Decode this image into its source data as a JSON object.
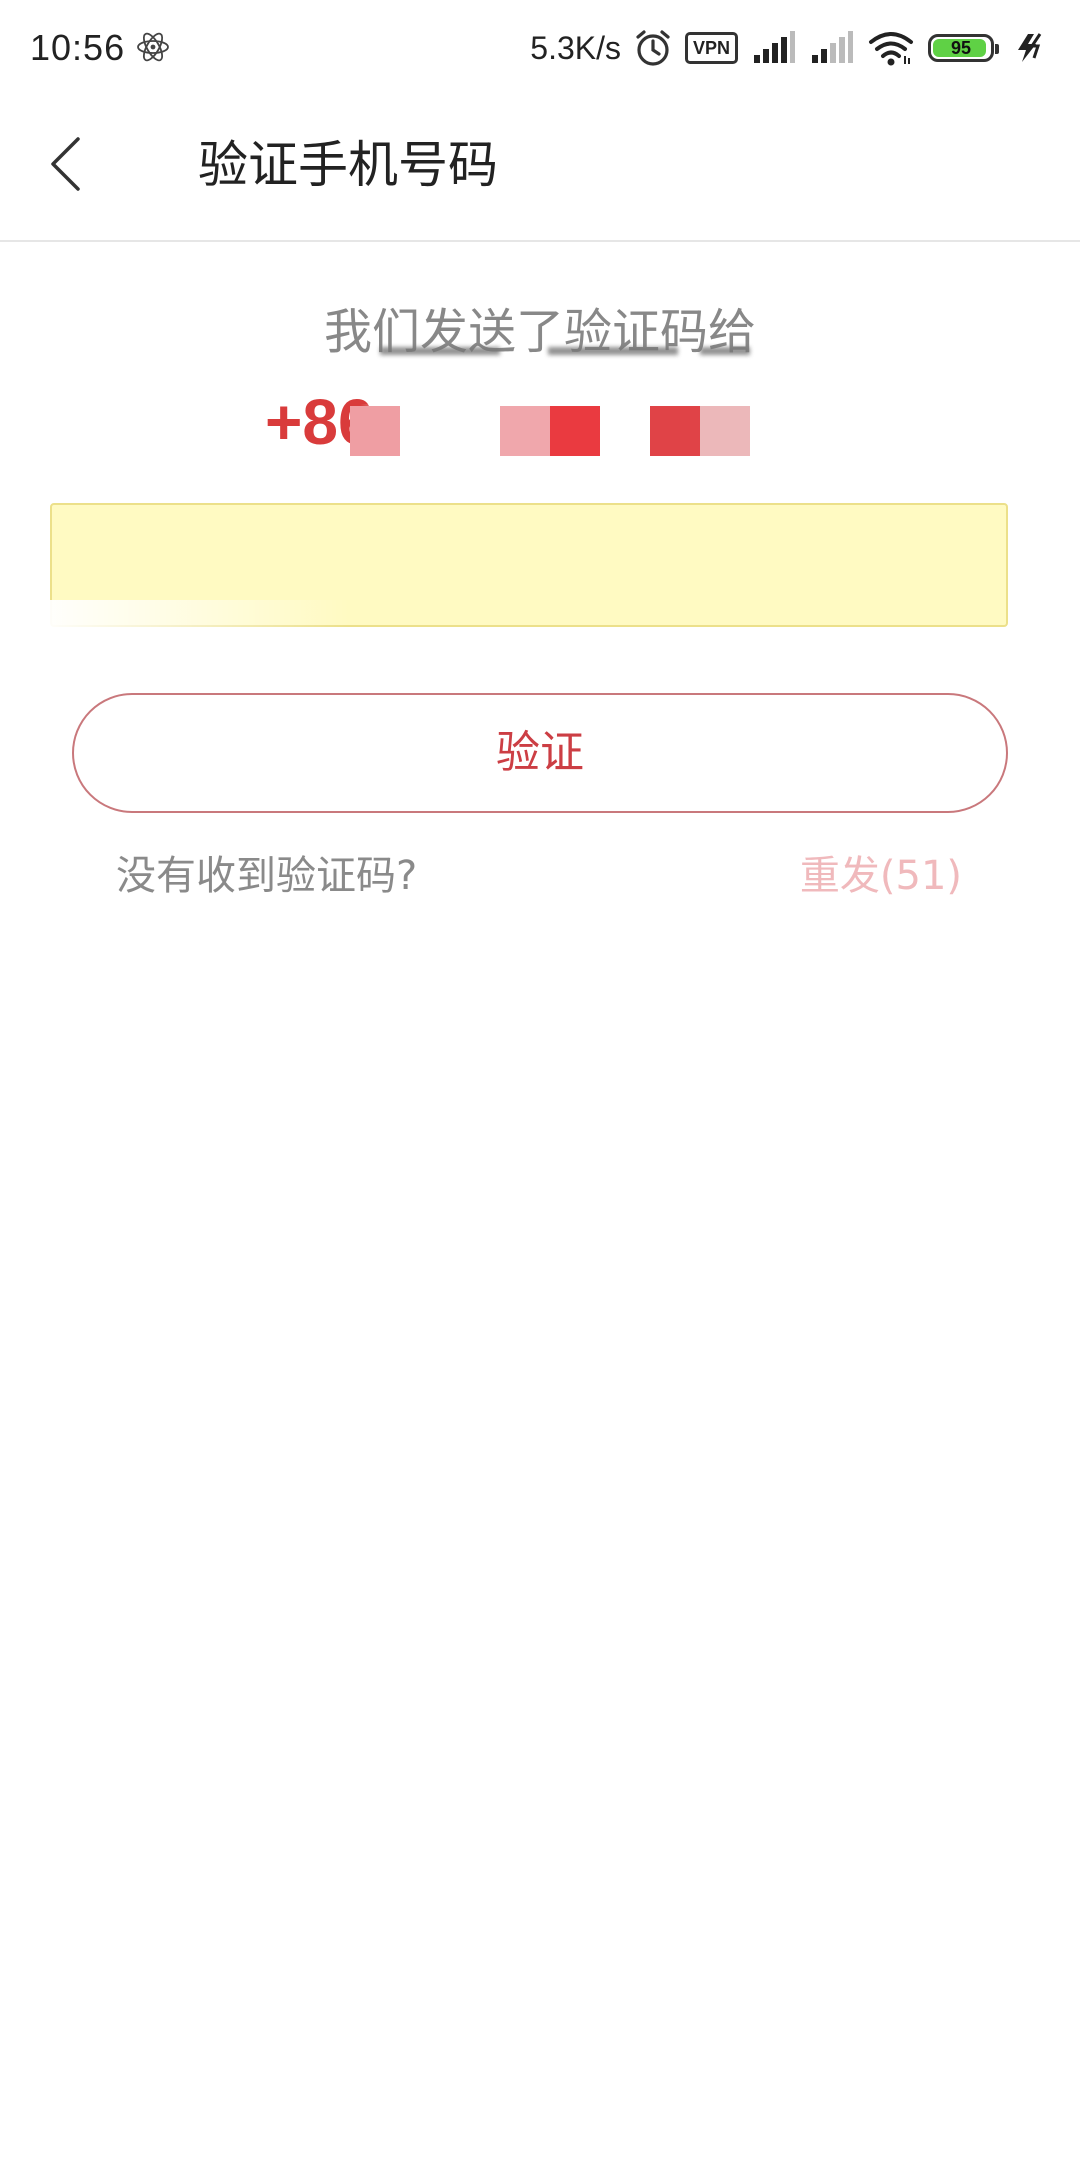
{
  "status_bar": {
    "time": "10:56",
    "net_speed": "5.3K/s",
    "vpn": "VPN",
    "battery_level": "95",
    "battery_fraction": 0.95,
    "icons": [
      "atom-icon",
      "alarm-icon",
      "vpn-icon",
      "signal-icon",
      "signal-icon-2",
      "wifi-icon",
      "battery-icon",
      "charging-icon"
    ]
  },
  "app_bar": {
    "title": "验证手机号码"
  },
  "main": {
    "sent_label": "我们发送了验证码给",
    "country_code": "+86",
    "code_input_value": "",
    "code_input_placeholder": "",
    "verify_button": "验证",
    "not_received": "没有收到验证码?",
    "resend_label": "重发",
    "resend_countdown": "(51)"
  },
  "colors": {
    "accent": "#cc3e44",
    "input_bg": "#fffac2",
    "resend_disabled": "#f0b9bc",
    "muted_text": "#8a8a8a"
  }
}
